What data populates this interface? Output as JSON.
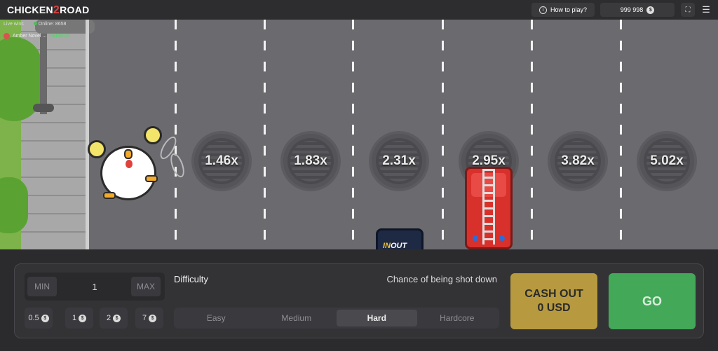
{
  "header": {
    "logo_left": "CHICKEN",
    "logo_num": "2",
    "logo_right": "ROAD",
    "how_to_play": "How to play?",
    "balance": "999 998",
    "currency_icon": "$"
  },
  "live": {
    "label": "Live wins",
    "online": "Online: 8658",
    "recent_win_name": "Amber Novel ...",
    "recent_win_amount": "+$160.00"
  },
  "multipliers": [
    "1.46x",
    "1.83x",
    "2.31x",
    "2.95x",
    "3.82x",
    "5.02x"
  ],
  "vehicles": {
    "van_label_a": "IN",
    "van_label_b": "OUT"
  },
  "bet": {
    "min_label": "MIN",
    "max_label": "MAX",
    "value": "1",
    "quick_amounts": [
      "0.5",
      "1",
      "2",
      "7"
    ]
  },
  "difficulty": {
    "label": "Difficulty",
    "chance_label": "Chance of being shot down",
    "options": [
      "Easy",
      "Medium",
      "Hard",
      "Hardcore"
    ],
    "selected": "Hard"
  },
  "actions": {
    "cashout_line1": "CASH OUT",
    "cashout_line2": "0 USD",
    "go": "GO"
  },
  "colors": {
    "background": "#2b2b2d",
    "road": "#6b6b6f",
    "cashout": "#b79a3f",
    "go": "#43a857",
    "win_amount": "#4cd964"
  }
}
